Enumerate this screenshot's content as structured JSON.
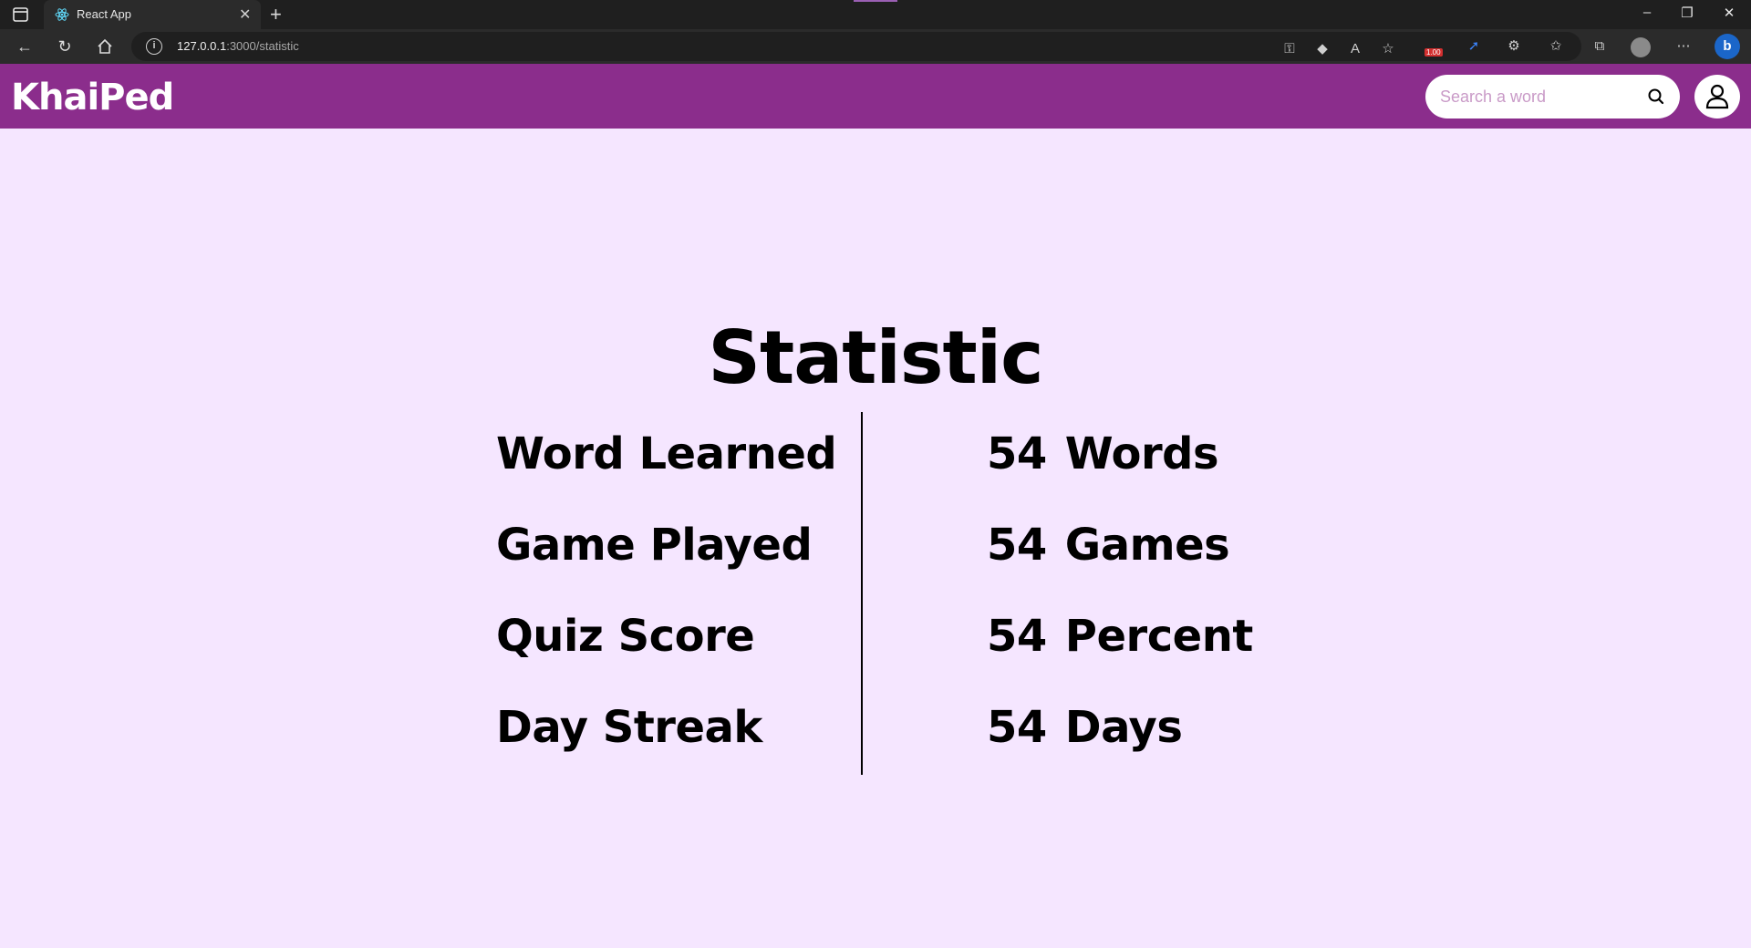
{
  "browser": {
    "tab_title": "React App",
    "url_host": "127.0.0.1",
    "url_path": ":3000/statistic",
    "extension_badge": "1.00"
  },
  "app": {
    "logo": "KhaiPed",
    "search_placeholder": "Search a word"
  },
  "main": {
    "title": "Statistic",
    "stats": [
      {
        "label": "Word Learned",
        "value": "54",
        "unit": "Words"
      },
      {
        "label": "Game Played",
        "value": "54",
        "unit": "Games"
      },
      {
        "label": "Quiz Score",
        "value": "54",
        "unit": "Percent"
      },
      {
        "label": "Day Streak",
        "value": "54",
        "unit": "Days"
      }
    ]
  },
  "colors": {
    "header": "#8b2d8c",
    "background": "#f5e6ff"
  }
}
